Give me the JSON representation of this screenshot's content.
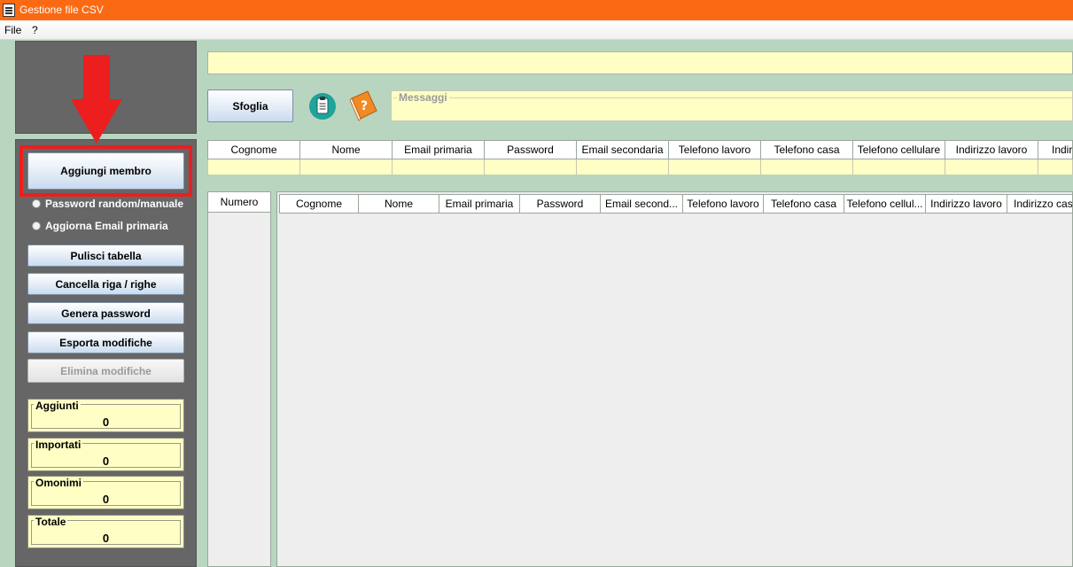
{
  "window": {
    "title": "Gestione file CSV"
  },
  "menu": {
    "file": "File",
    "help": "?"
  },
  "left": {
    "add_member": "Aggiungi membro",
    "radio_password": "Password random/manuale",
    "radio_email": "Aggiorna Email primaria",
    "clear_table": "Pulisci tabella",
    "delete_rows": "Cancella riga / righe",
    "generate_password": "Genera password",
    "export_changes": "Esporta modifiche",
    "discard_changes": "Elimina modifiche",
    "counters": [
      {
        "label": "Aggiunti",
        "value": "0"
      },
      {
        "label": "Importati",
        "value": "0"
      },
      {
        "label": "Omonimi",
        "value": "0"
      },
      {
        "label": "Totale",
        "value": "0"
      }
    ]
  },
  "main": {
    "path_value": "",
    "browse": "Sfoglia",
    "messages_legend": "Messaggi",
    "input_headers": [
      "Cognome",
      "Nome",
      "Email primaria",
      "Password",
      "Email secondaria",
      "Telefono lavoro",
      "Telefono casa",
      "Telefono cellulare",
      "Indirizzo lavoro",
      "Indir"
    ],
    "numero_header": "Numero",
    "data_headers": [
      "Cognome",
      "Nome",
      "Email primaria",
      "Password",
      "Email second...",
      "Telefono lavoro",
      "Telefono casa",
      "Telefono cellul...",
      "Indirizzo lavoro",
      "Indirizzo cas"
    ]
  },
  "colors": {
    "titlebar": "#fb6a12",
    "panel": "#666666",
    "field": "#ffffc5",
    "background": "#b8d5c0",
    "highlight": "#ec1e1e"
  },
  "icons": [
    "app-icon",
    "clipboard-icon",
    "help-book-icon",
    "down-arrow-icon"
  ]
}
